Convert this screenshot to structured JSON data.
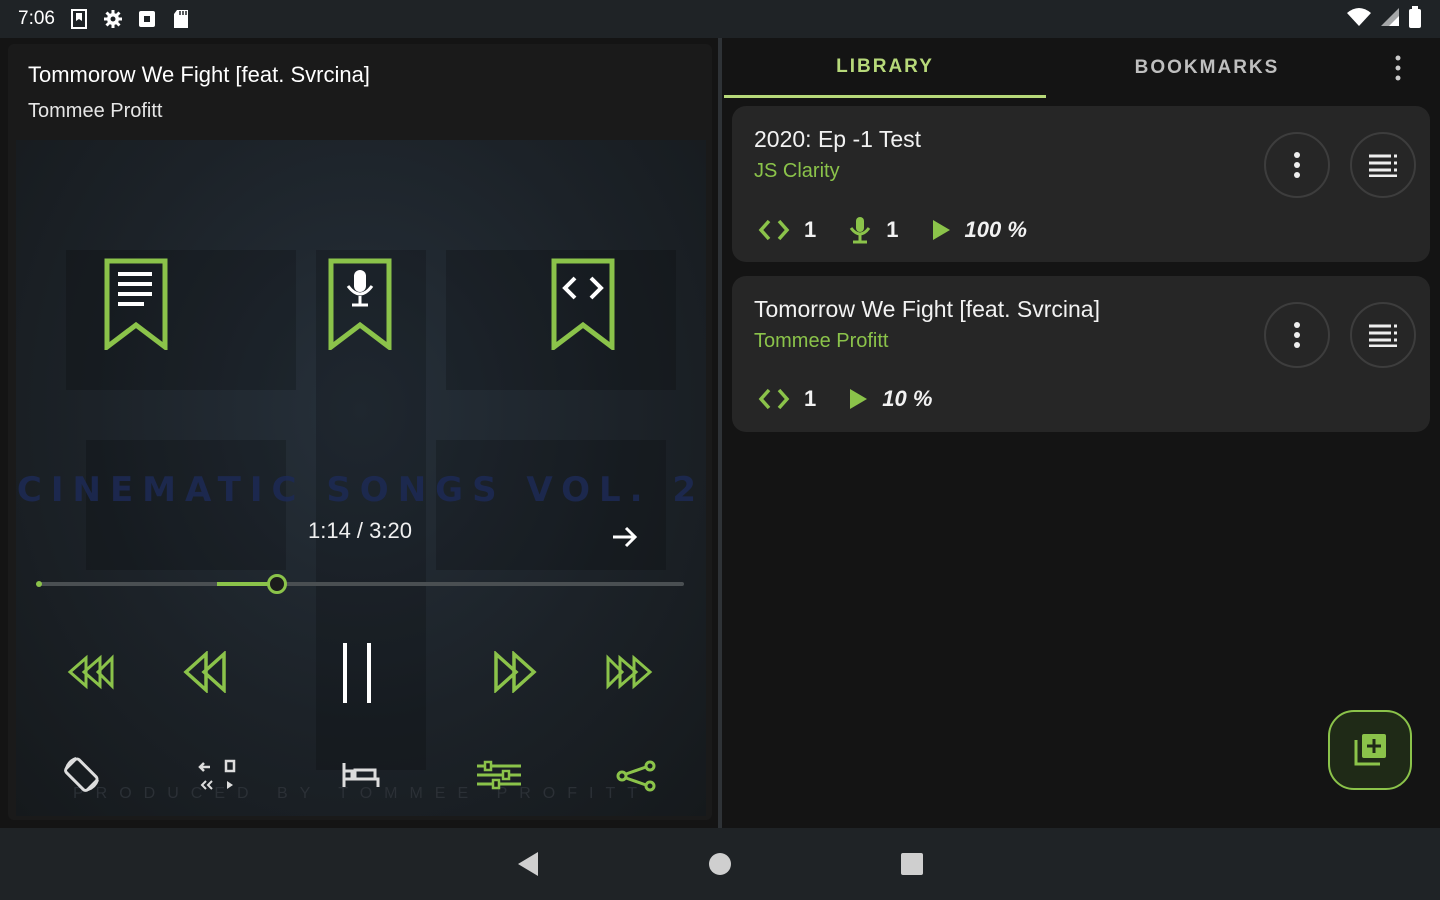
{
  "status_bar": {
    "time": "7:06",
    "icons": [
      "bookmark-status-icon",
      "settings-status-icon",
      "media-status-icon",
      "sd-card-icon"
    ],
    "right_icons": [
      "wifi-icon",
      "signal-icon",
      "battery-icon"
    ]
  },
  "player": {
    "title": "Tommorow We Fight [feat. Svrcina]",
    "artist": "Tommee Profitt",
    "album_art_text": "CINEMATIC SONGS VOL. 2",
    "album_art_credit": "PRODUCED BY TOMMEE PROFITT",
    "time_display": "1:14 / 3:20",
    "progress_fraction": 0.37,
    "bookmark_buttons": [
      "bookmark-text-icon",
      "bookmark-mic-icon",
      "bookmark-code-icon"
    ],
    "transport": [
      "rewind-far-icon",
      "rewind-icon",
      "pause-icon",
      "forward-icon",
      "forward-far-icon"
    ],
    "bottom_actions": [
      "screen-rotation-icon",
      "chapter-skip-icon",
      "sleep-timer-icon",
      "equalizer-icon",
      "share-icon"
    ]
  },
  "library": {
    "tabs": [
      {
        "label": "LIBRARY",
        "active": true
      },
      {
        "label": "BOOKMARKS",
        "active": false
      }
    ],
    "items": [
      {
        "title": "2020: Ep -1 Test",
        "author": "JS Clarity",
        "code_count": "1",
        "mic_count": "1",
        "progress": "100 %"
      },
      {
        "title": "Tomorrow We Fight [feat. Svrcina]",
        "author": "Tommee Profitt",
        "code_count": "1",
        "progress": "10 %"
      }
    ]
  },
  "colors": {
    "accent": "#8bc34a",
    "card": "#262626",
    "background": "#141414"
  }
}
